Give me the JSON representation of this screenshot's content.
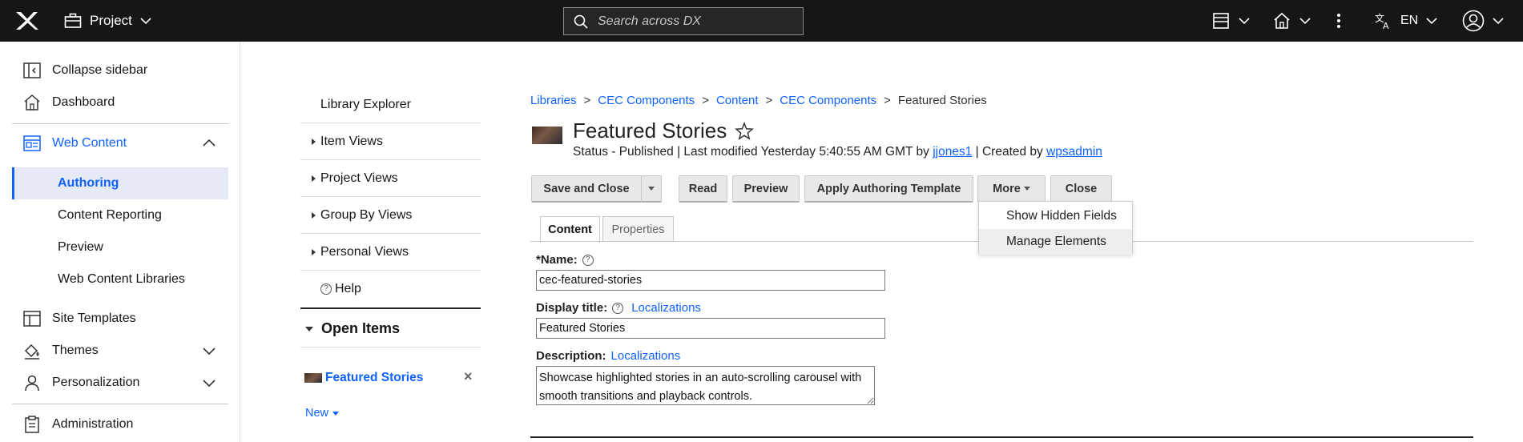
{
  "topbar": {
    "project_label": "Project",
    "search_placeholder": "Search across DX",
    "language": "EN"
  },
  "sidebar": {
    "collapse": "Collapse sidebar",
    "dashboard": "Dashboard",
    "web_content": "Web Content",
    "sub_items": [
      "Authoring",
      "Content Reporting",
      "Preview",
      "Web Content Libraries"
    ],
    "site_templates": "Site Templates",
    "themes": "Themes",
    "personalization": "Personalization",
    "administration": "Administration",
    "accent_color": "#0f62fe"
  },
  "library": {
    "explorer": "Library Explorer",
    "item_views": "Item Views",
    "project_views": "Project Views",
    "group_by_views": "Group By Views",
    "personal_views": "Personal Views",
    "help": "Help",
    "open_items_header": "Open Items",
    "open_item": "Featured Stories",
    "new_label": "New"
  },
  "breadcrumb": [
    "Libraries",
    "CEC Components",
    "Content",
    "CEC Components",
    "Featured Stories"
  ],
  "item": {
    "title": "Featured Stories",
    "status_prefix": "Status - Published | Last modified Yesterday 5:40:55 AM GMT by",
    "modified_by": "jjones1",
    "created_prefix": "| Created by",
    "created_by": "wpsadmin"
  },
  "toolbar": {
    "save_close": "Save and Close",
    "read": "Read",
    "preview": "Preview",
    "apply_template": "Apply Authoring Template",
    "more": "More",
    "close": "Close"
  },
  "more_menu": [
    "Show Hidden Fields",
    "Manage Elements"
  ],
  "tabs": [
    "Content",
    "Properties"
  ],
  "form": {
    "name_label": "Name:",
    "name_value": "cec-featured-stories",
    "display_title_label": "Display title:",
    "localizations": "Localizations",
    "display_title_value": "Featured Stories",
    "description_label": "Description:",
    "description_value": "Showcase highlighted stories in an auto-scrolling carousel with smooth transitions and playback controls."
  }
}
